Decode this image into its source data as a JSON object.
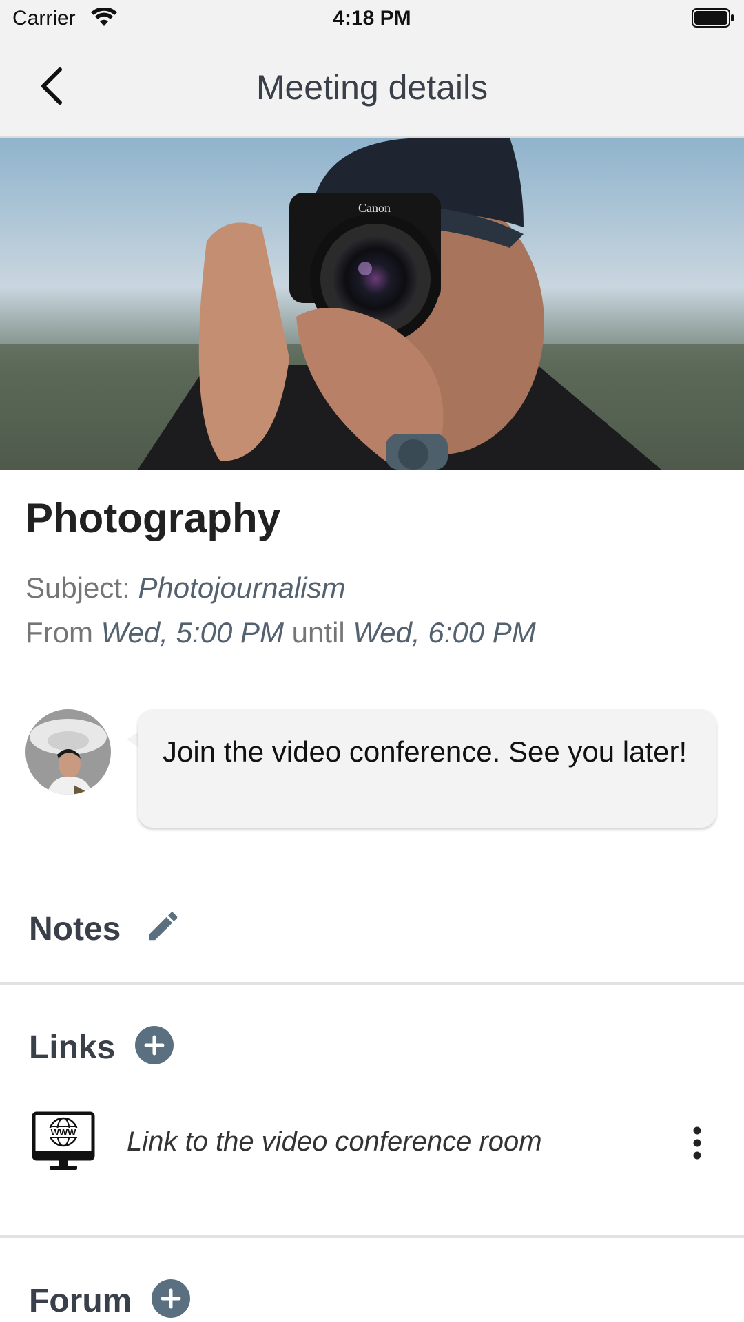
{
  "status_bar": {
    "carrier": "Carrier",
    "time": "4:18 PM"
  },
  "nav": {
    "title": "Meeting details"
  },
  "meeting": {
    "title": "Photography",
    "subject_label": "Subject: ",
    "subject_value": "Photojournalism",
    "from_label": "From ",
    "start": "Wed, 5:00 PM",
    "until_label": " until ",
    "end": "Wed, 6:00 PM"
  },
  "message": {
    "text": "Join the video conference. See you later!"
  },
  "sections": {
    "notes_title": "Notes",
    "links_title": "Links",
    "forum_title": "Forum"
  },
  "links": [
    {
      "label": "Link to the video conference room",
      "icon": "www-monitor-icon"
    }
  ],
  "colors": {
    "accent": "#5a7080",
    "heading": "#3a4049",
    "bar_background": "#f2f2f2"
  }
}
